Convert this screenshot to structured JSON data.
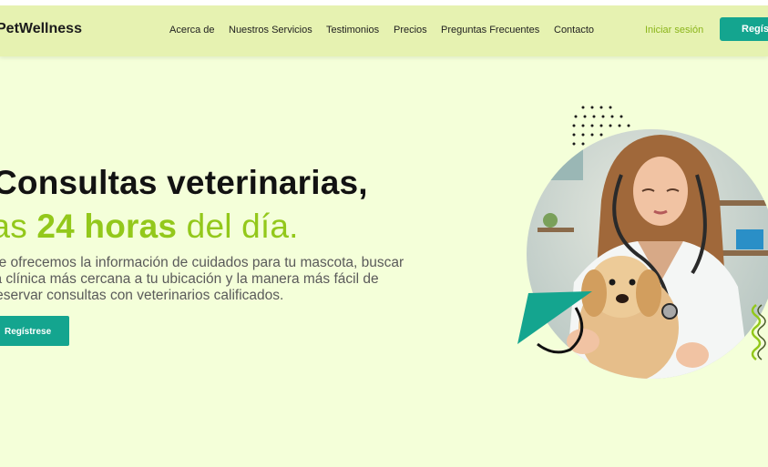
{
  "brand": {
    "name": "PetWellness"
  },
  "nav": {
    "links": [
      {
        "label": "Acerca de"
      },
      {
        "label": "Nuestros Servicios"
      },
      {
        "label": "Testimonios"
      },
      {
        "label": "Precios"
      },
      {
        "label": "Preguntas Frecuentes"
      },
      {
        "label": "Contacto"
      }
    ],
    "login_label": "Iniciar sesión",
    "register_label": "Regístrese"
  },
  "hero": {
    "title_line1": "Consultas veterinarias,",
    "title_line2_prefix": "las",
    "title_line2_bold": " 24 horas",
    "title_line2_suffix": " del día.",
    "description_lines": [
      "Le ofrecemos la información de cuidados para tu mascota, buscar",
      "la clínica más cercana a tu ubicación y la manera más fácil de",
      "reservar consultas con veterinarios calificados."
    ],
    "cta_label": "Regístrese",
    "image_alt": "Veterinaria con cachorro golden retriever"
  },
  "colors": {
    "background": "#f4ffd9",
    "navbar": "#e6f2b1",
    "accent_teal": "#14a58f",
    "accent_lime": "#93c81b"
  }
}
